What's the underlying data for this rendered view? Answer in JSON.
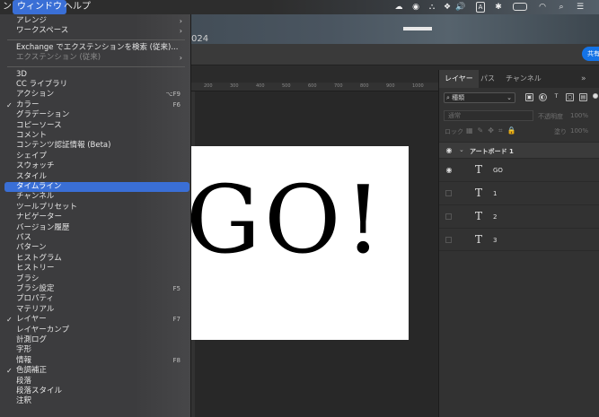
{
  "menubar": {
    "items": [
      {
        "label": "ン",
        "active": false
      },
      {
        "label": "ウィンドウ",
        "active": true
      },
      {
        "label": "ヘルプ",
        "active": false
      }
    ],
    "status_icons": [
      "creative-cloud-icon",
      "record-icon",
      "vpn-icon",
      "dropbox-icon",
      "volume-icon",
      "A",
      "bluetooth-icon",
      "battery-icon",
      "wifi-icon",
      "search-icon",
      "control-center-icon"
    ],
    "input_badge": "A"
  },
  "document": {
    "title_suffix": "024"
  },
  "ruler": {
    "ticks": [
      "200",
      "300",
      "400",
      "500",
      "600",
      "700",
      "800",
      "900",
      "1000",
      "1100"
    ]
  },
  "artboard": {
    "text": "GO!"
  },
  "layers_panel": {
    "tabs": [
      {
        "label": "レイヤー",
        "active": true
      },
      {
        "label": "パス",
        "active": false
      },
      {
        "label": "チャンネル",
        "active": false
      }
    ],
    "filter_label": "種類",
    "blend_mode": "通常",
    "opacity_label": "不透明度",
    "opacity_value": "100%",
    "lock_label": "ロック",
    "fill_label": "塗り",
    "fill_value": "100%",
    "group": {
      "name": "アートボード 1",
      "visible": true
    },
    "layers": [
      {
        "name": "GO",
        "visible": true
      },
      {
        "name": "1",
        "visible": false
      },
      {
        "name": "2",
        "visible": false
      },
      {
        "name": "3",
        "visible": false
      }
    ]
  },
  "share_label": "共有",
  "window_menu": {
    "items": [
      {
        "label": "アレンジ",
        "submenu": true
      },
      {
        "label": "ワークスペース",
        "submenu": true
      },
      {
        "separator": true
      },
      {
        "label": "Exchange でエクステンションを検索 (従来)..."
      },
      {
        "label": "エクステンション (従来)",
        "submenu": true,
        "disabled": true
      },
      {
        "separator": true
      },
      {
        "label": "3D"
      },
      {
        "label": "CC ライブラリ"
      },
      {
        "label": "アクション",
        "shortcut": "⌥F9"
      },
      {
        "label": "カラー",
        "shortcut": "F6",
        "checked": true
      },
      {
        "label": "グラデーション"
      },
      {
        "label": "コピーソース"
      },
      {
        "label": "コメント"
      },
      {
        "label": "コンテンツ認証情報 (Beta)"
      },
      {
        "label": "シェイプ"
      },
      {
        "label": "スウォッチ"
      },
      {
        "label": "スタイル"
      },
      {
        "label": "タイムライン",
        "highlighted": true
      },
      {
        "label": "チャンネル"
      },
      {
        "label": "ツールプリセット"
      },
      {
        "label": "ナビゲーター"
      },
      {
        "label": "バージョン履歴"
      },
      {
        "label": "パス"
      },
      {
        "label": "パターン"
      },
      {
        "label": "ヒストグラム"
      },
      {
        "label": "ヒストリー"
      },
      {
        "label": "ブラシ"
      },
      {
        "label": "ブラシ設定",
        "shortcut": "F5"
      },
      {
        "label": "プロパティ"
      },
      {
        "label": "マテリアル"
      },
      {
        "label": "レイヤー",
        "shortcut": "F7",
        "checked": true
      },
      {
        "label": "レイヤーカンプ"
      },
      {
        "label": "計測ログ"
      },
      {
        "label": "字形"
      },
      {
        "label": "情報",
        "shortcut": "F8"
      },
      {
        "label": "色調補正",
        "checked": true
      },
      {
        "label": "段落"
      },
      {
        "label": "段落スタイル"
      },
      {
        "label": "注釈"
      }
    ]
  }
}
